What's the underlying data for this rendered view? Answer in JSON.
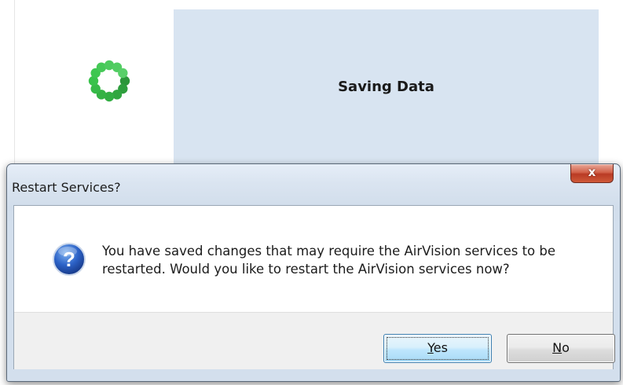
{
  "background_window": {
    "title": "Saving Data",
    "spinner_icon": "progress-spinner-icon"
  },
  "dialog": {
    "title": "Restart Services?",
    "close_label": "x",
    "icon": "question-icon",
    "message_line1": "You have saved changes that may require the AirVision services to be",
    "message_line2": "restarted.  Would you like to restart the AirVision services now?",
    "buttons": {
      "yes": {
        "mnemonic": "Y",
        "rest": "es"
      },
      "no": {
        "mnemonic": "N",
        "rest": "o"
      }
    }
  },
  "colors": {
    "panel": "#d8e4f1",
    "spinner": "#2e9a3c",
    "close_button": "#c4472c",
    "default_button": "#3c7fb1"
  }
}
